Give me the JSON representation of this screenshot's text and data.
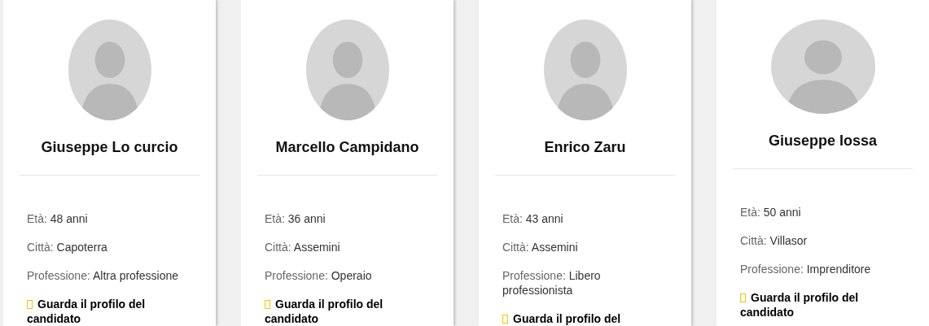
{
  "candidates": [
    {
      "photo": {
        "kind": "oval"
      },
      "name": "Giuseppe Lo curcio",
      "details": [
        {
          "label": "Età:",
          "value": "48 anni"
        },
        {
          "label": "Città:",
          "value": "Capoterra"
        },
        {
          "label": "Professione:",
          "value": "Altra professione"
        }
      ],
      "link": "Guarda il profilo del candidato"
    },
    {
      "photo": {
        "kind": "oval"
      },
      "name": "Marcello Campidano",
      "details": [
        {
          "label": "Età:",
          "value": "36 anni"
        },
        {
          "label": "Città:",
          "value": "Assemini"
        },
        {
          "label": "Professione:",
          "value": "Operaio"
        }
      ],
      "link": "Guarda il profilo del candidato"
    },
    {
      "photo": {
        "kind": "oval"
      },
      "name": "Enrico Zaru",
      "details": [
        {
          "label": "Età:",
          "value": "43 anni"
        },
        {
          "label": "Città:",
          "value": "Assemini"
        },
        {
          "label": "Professione:",
          "value": "Libero professionista"
        }
      ],
      "link": "Guarda il profilo del"
    },
    {
      "photo": {
        "kind": "circle"
      },
      "name": "Giuseppe Iossa",
      "details": [
        {
          "label": "Età:",
          "value": "50 anni"
        },
        {
          "label": "Città:",
          "value": "Villasor"
        },
        {
          "label": "Professione:",
          "value": "Imprenditore"
        }
      ],
      "link": "Guarda il profilo del candidato"
    }
  ]
}
